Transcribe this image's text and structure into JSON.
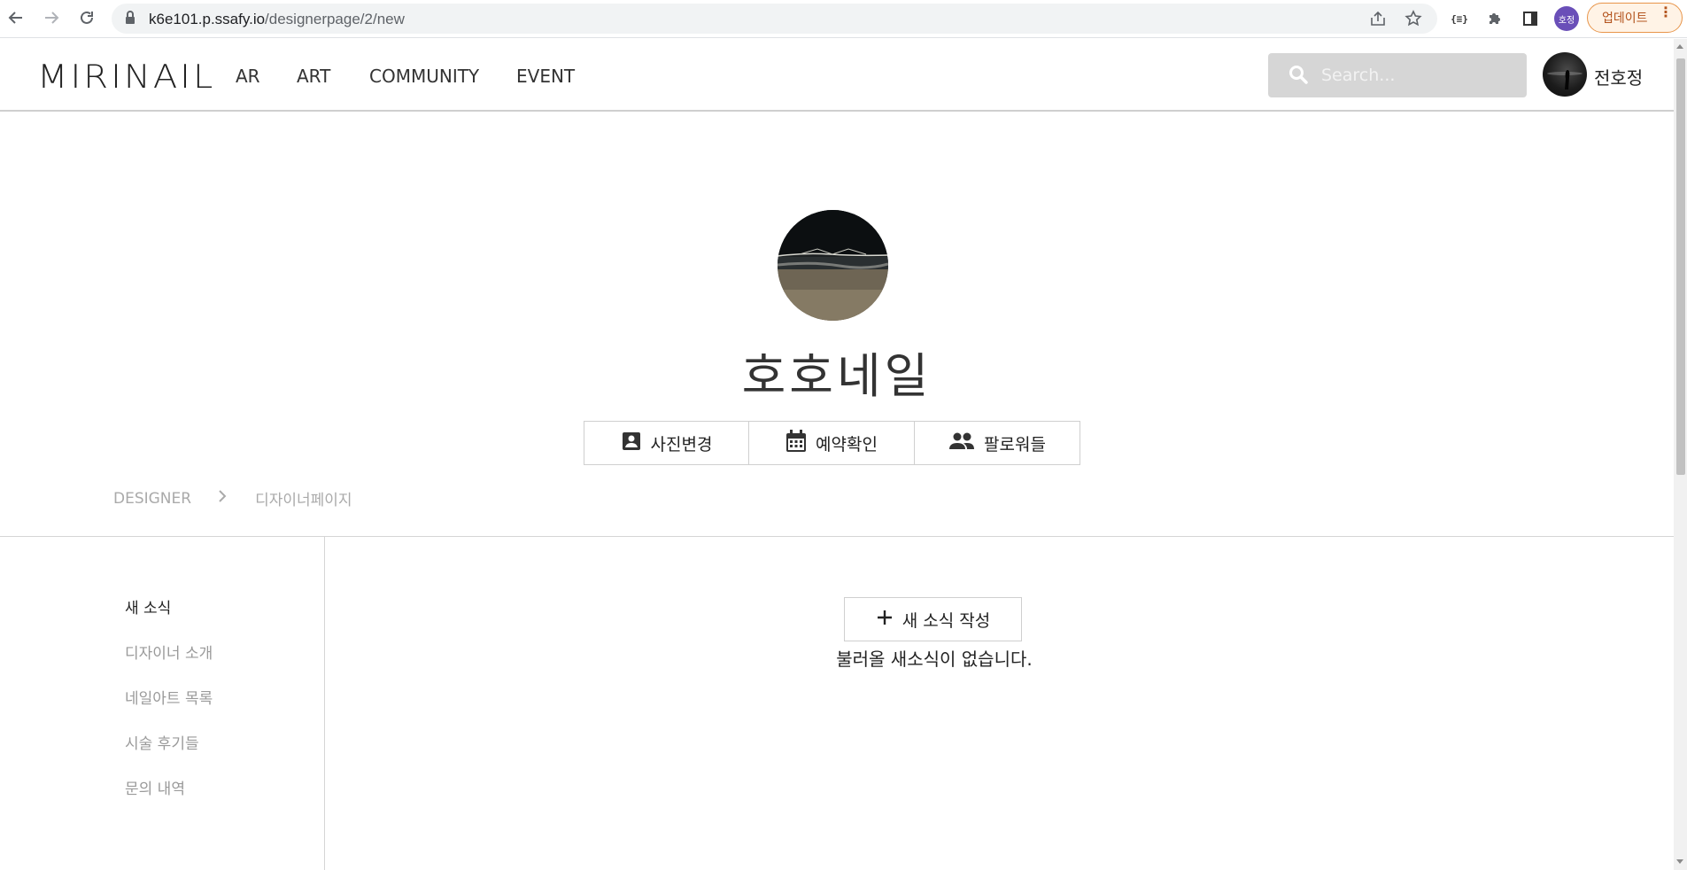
{
  "browser": {
    "url_host": "k6e101.p.ssafy.io",
    "url_path": "/designerpage/2/new",
    "profile_initials": "호정",
    "update_label": "업데이트"
  },
  "header": {
    "logo": "MIRINAIL",
    "nav": [
      "AR",
      "ART",
      "COMMUNITY",
      "EVENT"
    ],
    "search_placeholder": "Search...",
    "username": "전호정"
  },
  "profile": {
    "name": "호호네일",
    "actions": [
      {
        "label": "사진변경",
        "icon": "portrait-icon"
      },
      {
        "label": "예약확인",
        "icon": "calendar-icon"
      },
      {
        "label": "팔로워들",
        "icon": "people-icon"
      }
    ]
  },
  "breadcrumb": {
    "root": "DESIGNER",
    "current": "디자이너페이지"
  },
  "side_menu": {
    "items": [
      "새 소식",
      "디자이너 소개",
      "네일아트 목록",
      "시술 후기들",
      "문의 내역"
    ],
    "active_index": 0
  },
  "main": {
    "new_post_label": "새 소식 작성",
    "empty_message": "불러올 새소식이 없습니다."
  }
}
